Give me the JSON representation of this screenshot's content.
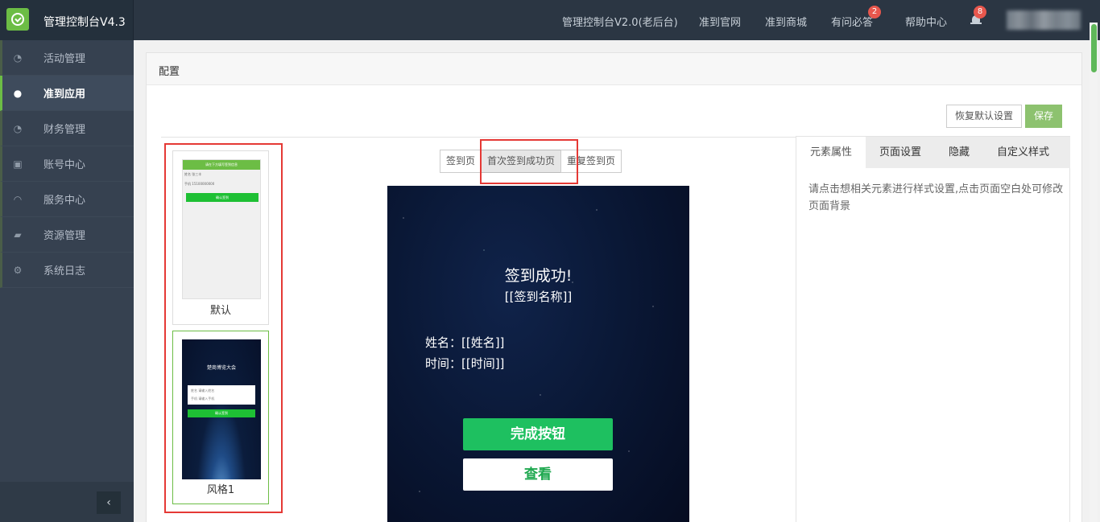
{
  "header": {
    "app_title": "管理控制台V4.3",
    "nav": [
      "管理控制台V2.0(老后台)",
      "准到官网",
      "准到商城",
      "有问必答",
      "帮助中心"
    ],
    "faq_badge": "2",
    "notify_badge": "8"
  },
  "sidebar": {
    "items": [
      {
        "label": "活动管理",
        "icon": "dashboard-icon"
      },
      {
        "label": "准到应用",
        "icon": "app-icon"
      },
      {
        "label": "财务管理",
        "icon": "finance-icon"
      },
      {
        "label": "账号中心",
        "icon": "account-icon"
      },
      {
        "label": "服务中心",
        "icon": "headset-icon"
      },
      {
        "label": "资源管理",
        "icon": "book-icon"
      },
      {
        "label": "系统日志",
        "icon": "gears-icon"
      }
    ],
    "active_index": 1,
    "collapse_glyph": "‹"
  },
  "panel": {
    "title": "配置",
    "reset_label": "恢复默认设置",
    "save_label": "保存"
  },
  "templates": [
    {
      "label": "默认",
      "preview": {
        "bar": "请在下方填写签到信息",
        "row1": "姓名  张三丰",
        "row2": "手机  15100000000",
        "button": "确认签到"
      }
    },
    {
      "label": "风格1",
      "preview": {
        "title": "楚商博览大会",
        "row1": "姓名    请输入姓名",
        "row2": "手机    请输入手机",
        "button": "确认签到"
      }
    }
  ],
  "page_tabs": [
    "签到页",
    "首次签到成功页",
    "重复签到页"
  ],
  "active_page_tab": 1,
  "phone": {
    "title": "签到成功!",
    "subtitle": "[[签到名称]]",
    "name_field": "姓名：[[姓名]]",
    "time_field": "时间：[[时间]]",
    "done_button": "完成按钮",
    "view_button": "查看"
  },
  "props": {
    "tabs": [
      "元素属性",
      "页面设置",
      "隐藏",
      "自定义样式"
    ],
    "active_tab": 0,
    "hint": "请点击想相关元素进行样式设置,点击页面空白处可修改页面背景"
  },
  "colors": {
    "brand_green": "#6cbd45",
    "topbar": "#2b3643",
    "sidebar": "#364150",
    "highlight_red": "#e53935",
    "done_button": "#1ec060"
  }
}
